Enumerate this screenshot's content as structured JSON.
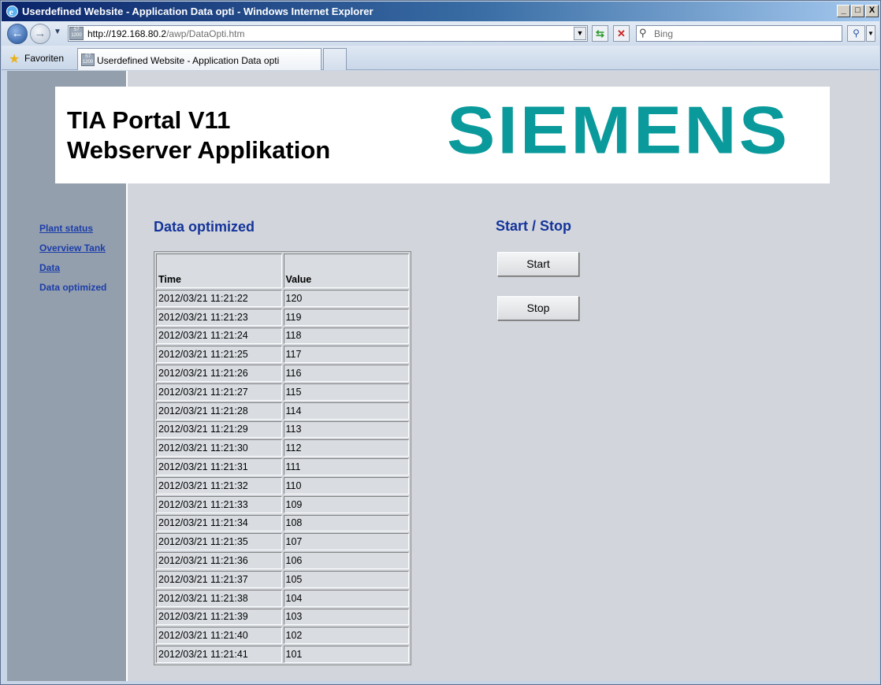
{
  "window": {
    "title": "Userdefined Website - Application Data opti - Windows Internet Explorer",
    "minimize_label": "_",
    "maximize_label": "□",
    "close_label": "X"
  },
  "navbar": {
    "url_host": "http://192.168.80.2",
    "url_path": "/awp/DataOpti.htm",
    "search_placeholder": "Bing",
    "site_icon_text": "S7 1200"
  },
  "favbar": {
    "favorites_label": "Favoriten",
    "tab_title": "Userdefined Website - Application Data opti"
  },
  "banner": {
    "line1": "TIA Portal V11",
    "line2": "Webserver Applikation",
    "logo": "SIEMENS"
  },
  "sidebar": {
    "items": [
      {
        "label": "Plant status",
        "current": false
      },
      {
        "label": "Overview Tank",
        "current": false
      },
      {
        "label": "Data",
        "current": false
      },
      {
        "label": "Data optimized",
        "current": true
      }
    ]
  },
  "main": {
    "data_title": "Data optimized",
    "control_title": "Start / Stop",
    "table": {
      "headers": [
        "Time",
        "Value"
      ],
      "rows": [
        [
          "2012/03/21 11:21:22",
          "120"
        ],
        [
          "2012/03/21 11:21:23",
          "119"
        ],
        [
          "2012/03/21 11:21:24",
          "118"
        ],
        [
          "2012/03/21 11:21:25",
          "117"
        ],
        [
          "2012/03/21 11:21:26",
          "116"
        ],
        [
          "2012/03/21 11:21:27",
          "115"
        ],
        [
          "2012/03/21 11:21:28",
          "114"
        ],
        [
          "2012/03/21 11:21:29",
          "113"
        ],
        [
          "2012/03/21 11:21:30",
          "112"
        ],
        [
          "2012/03/21 11:21:31",
          "111"
        ],
        [
          "2012/03/21 11:21:32",
          "110"
        ],
        [
          "2012/03/21 11:21:33",
          "109"
        ],
        [
          "2012/03/21 11:21:34",
          "108"
        ],
        [
          "2012/03/21 11:21:35",
          "107"
        ],
        [
          "2012/03/21 11:21:36",
          "106"
        ],
        [
          "2012/03/21 11:21:37",
          "105"
        ],
        [
          "2012/03/21 11:21:38",
          "104"
        ],
        [
          "2012/03/21 11:21:39",
          "103"
        ],
        [
          "2012/03/21 11:21:40",
          "102"
        ],
        [
          "2012/03/21 11:21:41",
          "101"
        ]
      ]
    },
    "start_label": "Start",
    "stop_label": "Stop"
  },
  "colors": {
    "siemens_teal": "#0a9a9b",
    "heading_blue": "#15349a",
    "link_blue": "#1c3ea8"
  }
}
